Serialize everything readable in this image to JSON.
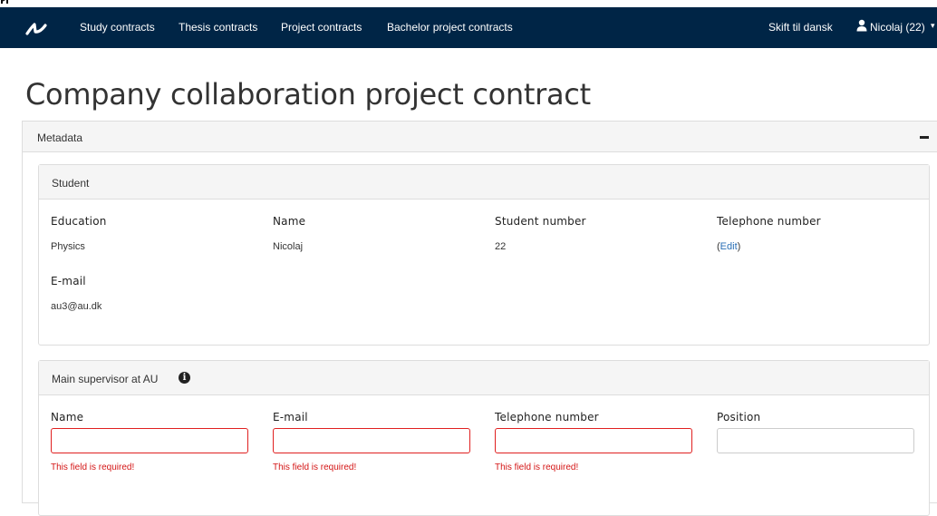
{
  "nav": {
    "items": [
      {
        "label": "Study contracts"
      },
      {
        "label": "Thesis contracts"
      },
      {
        "label": "Project contracts"
      },
      {
        "label": "Bachelor project contracts"
      }
    ],
    "language_switch": "Skift til dansk",
    "user_label": "Nicolaj (22)"
  },
  "page": {
    "title": "Company collaboration project contract"
  },
  "metadata": {
    "heading": "Metadata",
    "student": {
      "heading": "Student",
      "fields": [
        {
          "label": "Education",
          "value": "Physics"
        },
        {
          "label": "Name",
          "value": "Nicolaj"
        },
        {
          "label": "Student number",
          "value": "22"
        },
        {
          "label": "Telephone number",
          "value": "(",
          "link": "Edit",
          "value_end": ")"
        }
      ],
      "email_label": "E-mail",
      "email_value": "au3@au.dk"
    },
    "supervisor": {
      "heading": "Main supervisor at AU",
      "fields": [
        {
          "label": "Name",
          "value": "",
          "error": "This field is required!"
        },
        {
          "label": "E-mail",
          "value": "",
          "error": "This field is required!"
        },
        {
          "label": "Telephone number",
          "value": "",
          "error": "This field is required!"
        },
        {
          "label": "Position",
          "value": ""
        }
      ]
    }
  },
  "colors": {
    "navbar": "#002546",
    "error": "#d41515",
    "link": "#2a6fb5"
  }
}
